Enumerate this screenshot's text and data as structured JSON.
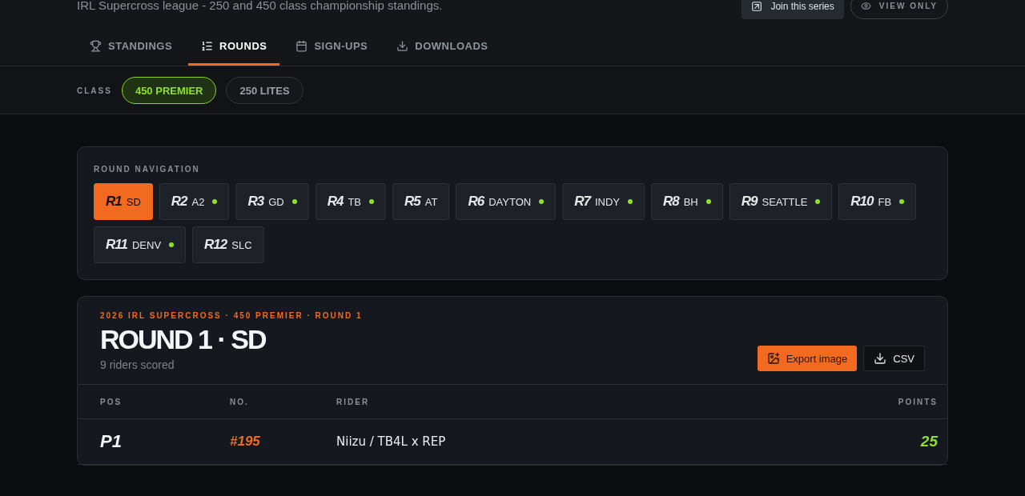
{
  "header": {
    "subtitle": "IRL Supercross league - 250 and 450 class championship standings.",
    "actions": [
      {
        "kind": "join",
        "label": "Join this series"
      },
      {
        "kind": "view",
        "label": "VIEW ONLY"
      }
    ]
  },
  "tabs": [
    {
      "label": "STANDINGS",
      "selected": false
    },
    {
      "label": "ROUNDS",
      "selected": true
    },
    {
      "label": "SIGN-UPS",
      "selected": false
    },
    {
      "label": "DOWNLOADS",
      "selected": false
    }
  ],
  "class_filter": {
    "label": "CLASS",
    "options": [
      {
        "label": "450 PREMIER",
        "selected": true
      },
      {
        "label": "250 LITES",
        "selected": false
      }
    ]
  },
  "round_navigation": {
    "title": "ROUND NAVIGATION",
    "rounds": [
      {
        "number": "R1",
        "venue": "SD",
        "scored": false,
        "selected": true
      },
      {
        "number": "R2",
        "venue": "A2",
        "scored": true,
        "selected": false
      },
      {
        "number": "R3",
        "venue": "GD",
        "scored": true,
        "selected": false
      },
      {
        "number": "R4",
        "venue": "TB",
        "scored": true,
        "selected": false
      },
      {
        "number": "R5",
        "venue": "AT",
        "scored": false,
        "selected": false
      },
      {
        "number": "R6",
        "venue": "DAYTON",
        "scored": true,
        "selected": false
      },
      {
        "number": "R7",
        "venue": "INDY",
        "scored": true,
        "selected": false
      },
      {
        "number": "R8",
        "venue": "BH",
        "scored": true,
        "selected": false
      },
      {
        "number": "R9",
        "venue": "SEATTLE",
        "scored": true,
        "selected": false
      },
      {
        "number": "R10",
        "venue": "FB",
        "scored": true,
        "selected": false
      },
      {
        "number": "R11",
        "venue": "DENV",
        "scored": true,
        "selected": false
      },
      {
        "number": "R12",
        "venue": "SLC",
        "scored": false,
        "selected": false
      }
    ]
  },
  "results": {
    "eyebrow": "2026 IRL SUPERCROSS · 450 PREMIER · ROUND 1",
    "title": "ROUND 1 · SD",
    "summary": "9 riders scored",
    "buttons": [
      {
        "kind": "image",
        "label": "Export image"
      },
      {
        "kind": "csv",
        "label": "CSV"
      }
    ],
    "table": {
      "columns": [
        "POS",
        "NO.",
        "RIDER",
        "POINTS"
      ],
      "rows": [
        {
          "pos": "P1",
          "number": "#195",
          "rider": "Niizu / TB4L x REP",
          "points": "25"
        }
      ]
    }
  }
}
